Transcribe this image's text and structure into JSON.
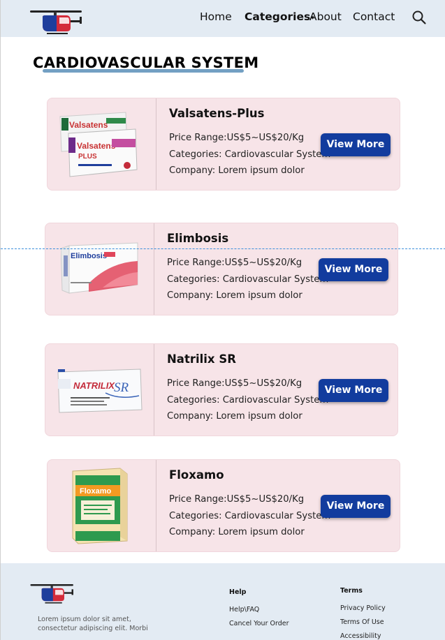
{
  "header": {
    "nav": {
      "home": "Home",
      "categories": "Categories",
      "categories_caret": "▾",
      "about": "About",
      "contact": "Contact"
    },
    "search_icon": "search-icon"
  },
  "page": {
    "title": "CARDIOVASCULAR SYSTEM"
  },
  "products": [
    {
      "name": "Valsatens-Plus",
      "price": "Price Range:US$5~US$20/Kg",
      "categories": "Categories: Cardiovascular System",
      "company": "Company: Lorem ipsum dolor",
      "button": "View More",
      "package_text": "Valsatens",
      "package_sub": "PLUS"
    },
    {
      "name": "Elimbosis",
      "price": "Price Range:US$5~US$20/Kg",
      "categories": "Categories: Cardiovascular System",
      "company": "Company: Lorem ipsum dolor",
      "button": "View More",
      "package_text": "Elimbosis"
    },
    {
      "name": "Natrilix SR",
      "price": "Price Range:US$5~US$20/Kg",
      "categories": "Categories: Cardiovascular System",
      "company": "Company: Lorem ipsum dolor",
      "button": "View More",
      "package_text": "NATRILIX",
      "package_sub": "SR"
    },
    {
      "name": "Floxamo",
      "price": "Price Range:US$5~US$20/Kg",
      "categories": "Categories: Cardiovascular System",
      "company": "Company: Lorem ipsum dolor",
      "button": "View More",
      "package_text": "Floxamo"
    }
  ],
  "footer": {
    "description": "Lorem ipsum dolor sit amet, consectetur adipiscing elit. Morbi",
    "help": {
      "heading": "Help",
      "links": [
        "Help\\FAQ",
        "Cancel Your Order"
      ]
    },
    "terms": {
      "heading": "Terms",
      "links": [
        "Privacy Policy",
        "Terms Of Use",
        "Accessibility"
      ]
    }
  },
  "colors": {
    "header_bg": "#e3ebf3",
    "card_bg": "#f7e4e8",
    "button_bg": "#123c9e",
    "guide_line": "#3b8fdc"
  }
}
